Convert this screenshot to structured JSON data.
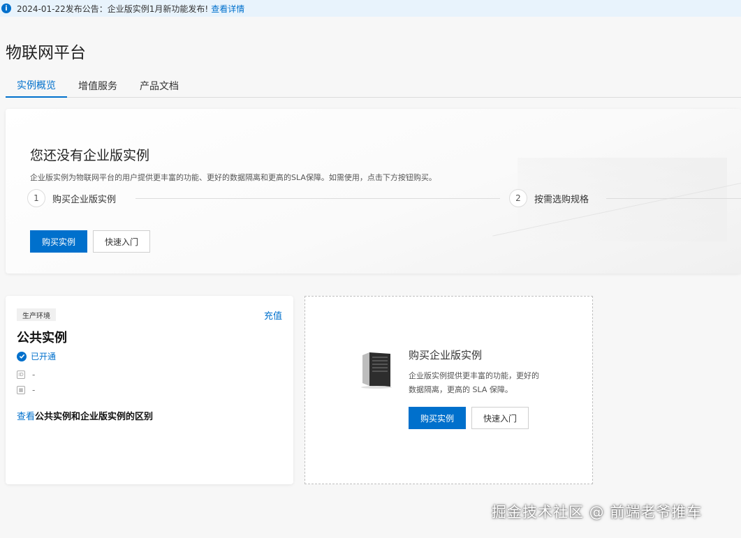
{
  "notice": {
    "text": "2024-01-22发布公告：企业版实例1月新功能发布!",
    "link": "查看详情"
  },
  "page": {
    "title": "物联网平台"
  },
  "tabs": [
    {
      "label": "实例概览",
      "active": true
    },
    {
      "label": "增值服务",
      "active": false
    },
    {
      "label": "产品文档",
      "active": false
    }
  ],
  "hero": {
    "title": "您还没有企业版实例",
    "description": "企业版实例为物联网平台的用户提供更丰富的功能、更好的数据隔离和更高的SLA保障。如需使用，点击下方按钮购买。",
    "steps": [
      {
        "num": "1",
        "label": "购买企业版实例"
      },
      {
        "num": "2",
        "label": "按需选购规格"
      }
    ],
    "buy_button": "购买实例",
    "quickstart_button": "快速入门"
  },
  "public_card": {
    "env_badge": "生产环境",
    "recharge": "充值",
    "title": "公共实例",
    "status": "已开通",
    "id_value": "-",
    "date_value": "-",
    "compare_link": "查看",
    "compare_text": "公共实例和企业版实例的区别"
  },
  "buy_card": {
    "title": "购买企业版实例",
    "description": "企业版实例提供更丰富的功能，更好的数据隔离，更高的 SLA 保障。",
    "buy_button": "购买实例",
    "quickstart_button": "快速入门"
  },
  "watermark": "掘金技术社区 @ 前端老爷推车",
  "colors": {
    "accent": "#0070cc",
    "notice_bg": "#e8f3fc",
    "page_bg": "#f7f7f7"
  }
}
